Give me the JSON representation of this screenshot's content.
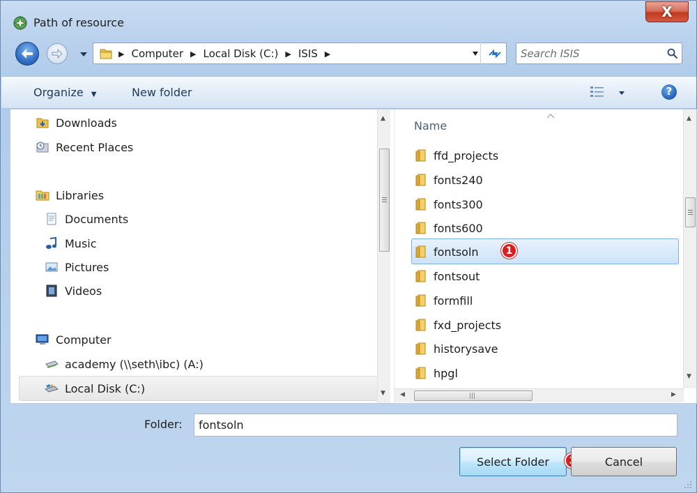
{
  "window": {
    "title": "Path of resource",
    "close_label": "X"
  },
  "address": {
    "crumbs": [
      "Computer",
      "Local Disk (C:)",
      "ISIS"
    ],
    "search_placeholder": "Search ISIS"
  },
  "toolbar": {
    "organize_label": "Organize",
    "newfolder_label": "New folder",
    "help_label": "?"
  },
  "nav": {
    "items": [
      {
        "label": "Downloads",
        "icon": "downloads-icon"
      },
      {
        "label": "Recent Places",
        "icon": "recent-places-icon"
      },
      {
        "label": "Libraries",
        "icon": "libraries-icon"
      },
      {
        "label": "Documents",
        "icon": "documents-icon"
      },
      {
        "label": "Music",
        "icon": "music-icon"
      },
      {
        "label": "Pictures",
        "icon": "pictures-icon"
      },
      {
        "label": "Videos",
        "icon": "videos-icon"
      },
      {
        "label": "Computer",
        "icon": "computer-icon"
      },
      {
        "label": "academy (\\\\seth\\ibc) (A:)",
        "icon": "network-drive-icon"
      },
      {
        "label": "Local Disk (C:)",
        "icon": "local-disk-icon",
        "selected": true
      }
    ]
  },
  "files": {
    "column_name": "Name",
    "items": [
      {
        "label": "ffd_projects"
      },
      {
        "label": "fonts240"
      },
      {
        "label": "fonts300"
      },
      {
        "label": "fonts600"
      },
      {
        "label": "fontsoln",
        "selected": true
      },
      {
        "label": "fontsout"
      },
      {
        "label": "formfill"
      },
      {
        "label": "fxd_projects"
      },
      {
        "label": "historysave"
      },
      {
        "label": "hpgl"
      }
    ],
    "selected_marker": "1"
  },
  "footer": {
    "folder_label": "Folder:",
    "folder_value": "fontsoln",
    "select_label": "Select Folder",
    "cancel_label": "Cancel",
    "select_marker": "2"
  },
  "colors": {
    "selection_fill": "#cde3f8",
    "marker_red": "#d81e1e",
    "toolbar_text": "#1e395b"
  }
}
